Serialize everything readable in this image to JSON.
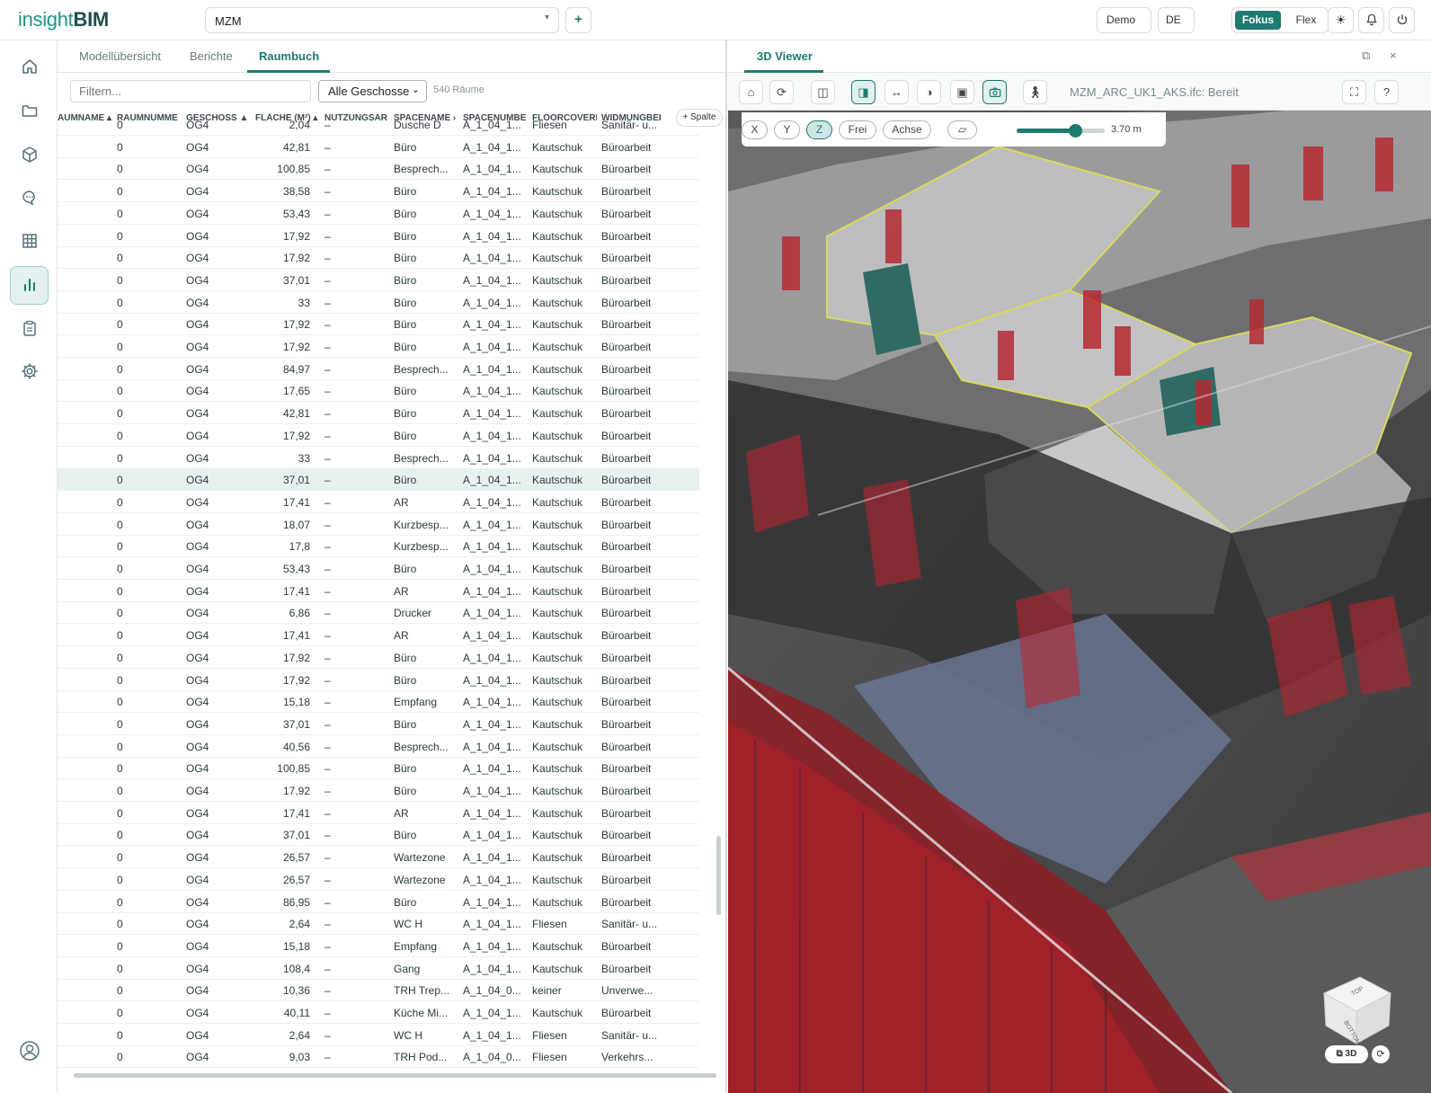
{
  "app": {
    "logo_light": "insight",
    "logo_bold": "BIM"
  },
  "header": {
    "project": "MZM",
    "add_label": "+",
    "demo": "Demo",
    "lang": "DE",
    "mode_fokus": "Fokus",
    "mode_flex": "Flex",
    "icons": [
      "sun-icon",
      "bell-icon",
      "power-icon"
    ]
  },
  "sidebar": [
    "home-icon",
    "folder-icon",
    "cube-icon",
    "chat-icon",
    "grid-icon",
    "chart-icon",
    "clipboard-icon",
    "gear-icon",
    "user-icon"
  ],
  "left": {
    "tabs": [
      "Modellübersicht",
      "Berichte",
      "Raumbuch"
    ],
    "active_tab": "Raumbuch",
    "filter_placeholder": "Filtern...",
    "floor_select": "Alle Geschosse",
    "room_count": "540 Räume",
    "columns": [
      "AUMNAME",
      "RAUMNUMME",
      "GESCHOSS ▲",
      "FLÄCHE (M²)",
      "NUTZUNGSAR",
      "SPACENAME",
      "SPACENUMBE",
      "FLOORCOVERI",
      "WIDMUNGBEI"
    ],
    "add_column": "+ Spalte",
    "rows": [
      [
        "0",
        "OG4",
        "2,04",
        "–",
        "Dusche D",
        "A_1_04_1...",
        "Fliesen",
        "Sanitär- u..."
      ],
      [
        "0",
        "OG4",
        "42,81",
        "–",
        "Büro",
        "A_1_04_1...",
        "Kautschuk",
        "Büroarbeit"
      ],
      [
        "0",
        "OG4",
        "100,85",
        "–",
        "Besprech...",
        "A_1_04_1...",
        "Kautschuk",
        "Büroarbeit"
      ],
      [
        "0",
        "OG4",
        "38,58",
        "–",
        "Büro",
        "A_1_04_1...",
        "Kautschuk",
        "Büroarbeit"
      ],
      [
        "0",
        "OG4",
        "53,43",
        "–",
        "Büro",
        "A_1_04_1...",
        "Kautschuk",
        "Büroarbeit"
      ],
      [
        "0",
        "OG4",
        "17,92",
        "–",
        "Büro",
        "A_1_04_1...",
        "Kautschuk",
        "Büroarbeit"
      ],
      [
        "0",
        "OG4",
        "17,92",
        "–",
        "Büro",
        "A_1_04_1...",
        "Kautschuk",
        "Büroarbeit"
      ],
      [
        "0",
        "OG4",
        "37,01",
        "–",
        "Büro",
        "A_1_04_1...",
        "Kautschuk",
        "Büroarbeit"
      ],
      [
        "0",
        "OG4",
        "33",
        "–",
        "Büro",
        "A_1_04_1...",
        "Kautschuk",
        "Büroarbeit"
      ],
      [
        "0",
        "OG4",
        "17,92",
        "–",
        "Büro",
        "A_1_04_1...",
        "Kautschuk",
        "Büroarbeit"
      ],
      [
        "0",
        "OG4",
        "17,92",
        "–",
        "Büro",
        "A_1_04_1...",
        "Kautschuk",
        "Büroarbeit"
      ],
      [
        "0",
        "OG4",
        "84,97",
        "–",
        "Besprech...",
        "A_1_04_1...",
        "Kautschuk",
        "Büroarbeit"
      ],
      [
        "0",
        "OG4",
        "17,65",
        "–",
        "Büro",
        "A_1_04_1...",
        "Kautschuk",
        "Büroarbeit"
      ],
      [
        "0",
        "OG4",
        "42,81",
        "–",
        "Büro",
        "A_1_04_1...",
        "Kautschuk",
        "Büroarbeit"
      ],
      [
        "0",
        "OG4",
        "17,92",
        "–",
        "Büro",
        "A_1_04_1...",
        "Kautschuk",
        "Büroarbeit"
      ],
      [
        "0",
        "OG4",
        "33",
        "–",
        "Besprech...",
        "A_1_04_1...",
        "Kautschuk",
        "Büroarbeit"
      ],
      [
        "0",
        "OG4",
        "37,01",
        "–",
        "Büro",
        "A_1_04_1...",
        "Kautschuk",
        "Büroarbeit"
      ],
      [
        "0",
        "OG4",
        "17,41",
        "–",
        "AR",
        "A_1_04_1...",
        "Kautschuk",
        "Büroarbeit"
      ],
      [
        "0",
        "OG4",
        "18,07",
        "–",
        "Kurzbesp...",
        "A_1_04_1...",
        "Kautschuk",
        "Büroarbeit"
      ],
      [
        "0",
        "OG4",
        "17,8",
        "–",
        "Kurzbesp...",
        "A_1_04_1...",
        "Kautschuk",
        "Büroarbeit"
      ],
      [
        "0",
        "OG4",
        "53,43",
        "–",
        "Büro",
        "A_1_04_1...",
        "Kautschuk",
        "Büroarbeit"
      ],
      [
        "0",
        "OG4",
        "17,41",
        "–",
        "AR",
        "A_1_04_1...",
        "Kautschuk",
        "Büroarbeit"
      ],
      [
        "0",
        "OG4",
        "6,86",
        "–",
        "Drucker",
        "A_1_04_1...",
        "Kautschuk",
        "Büroarbeit"
      ],
      [
        "0",
        "OG4",
        "17,41",
        "–",
        "AR",
        "A_1_04_1...",
        "Kautschuk",
        "Büroarbeit"
      ],
      [
        "0",
        "OG4",
        "17,92",
        "–",
        "Büro",
        "A_1_04_1...",
        "Kautschuk",
        "Büroarbeit"
      ],
      [
        "0",
        "OG4",
        "17,92",
        "–",
        "Büro",
        "A_1_04_1...",
        "Kautschuk",
        "Büroarbeit"
      ],
      [
        "0",
        "OG4",
        "15,18",
        "–",
        "Empfang",
        "A_1_04_1...",
        "Kautschuk",
        "Büroarbeit"
      ],
      [
        "0",
        "OG4",
        "37,01",
        "–",
        "Büro",
        "A_1_04_1...",
        "Kautschuk",
        "Büroarbeit"
      ],
      [
        "0",
        "OG4",
        "40,56",
        "–",
        "Besprech...",
        "A_1_04_1...",
        "Kautschuk",
        "Büroarbeit"
      ],
      [
        "0",
        "OG4",
        "100,85",
        "–",
        "Büro",
        "A_1_04_1...",
        "Kautschuk",
        "Büroarbeit"
      ],
      [
        "0",
        "OG4",
        "17,92",
        "–",
        "Büro",
        "A_1_04_1...",
        "Kautschuk",
        "Büroarbeit"
      ],
      [
        "0",
        "OG4",
        "17,41",
        "–",
        "AR",
        "A_1_04_1...",
        "Kautschuk",
        "Büroarbeit"
      ],
      [
        "0",
        "OG4",
        "37,01",
        "–",
        "Büro",
        "A_1_04_1...",
        "Kautschuk",
        "Büroarbeit"
      ],
      [
        "0",
        "OG4",
        "26,57",
        "–",
        "Wartezone",
        "A_1_04_1...",
        "Kautschuk",
        "Büroarbeit"
      ],
      [
        "0",
        "OG4",
        "26,57",
        "–",
        "Wartezone",
        "A_1_04_1...",
        "Kautschuk",
        "Büroarbeit"
      ],
      [
        "0",
        "OG4",
        "86,95",
        "–",
        "Büro",
        "A_1_04_1...",
        "Kautschuk",
        "Büroarbeit"
      ],
      [
        "0",
        "OG4",
        "2,64",
        "–",
        "WC H",
        "A_1_04_1...",
        "Fliesen",
        "Sanitär- u..."
      ],
      [
        "0",
        "OG4",
        "15,18",
        "–",
        "Empfang",
        "A_1_04_1...",
        "Kautschuk",
        "Büroarbeit"
      ],
      [
        "0",
        "OG4",
        "108,4",
        "–",
        "Gang",
        "A_1_04_1...",
        "Kautschuk",
        "Büroarbeit"
      ],
      [
        "0",
        "OG4",
        "10,36",
        "–",
        "TRH Trep...",
        "A_1_04_0...",
        "keiner",
        "Unverwe..."
      ],
      [
        "0",
        "OG4",
        "40,11",
        "–",
        "Küche Mi...",
        "A_1_04_1...",
        "Kautschuk",
        "Büroarbeit"
      ],
      [
        "0",
        "OG4",
        "2,64",
        "–",
        "WC H",
        "A_1_04_1...",
        "Fliesen",
        "Sanitär- u..."
      ],
      [
        "0",
        "OG4",
        "9,03",
        "–",
        "TRH Pod...",
        "A_1_04_0...",
        "Fliesen",
        "Verkehrs..."
      ]
    ],
    "selected_row": 16
  },
  "viewer": {
    "title": "3D Viewer",
    "status": "MZM_ARC_UK1_AKS.ifc: Bereit",
    "clip_axes": [
      "X",
      "Y",
      "Z",
      "Frei",
      "Achse"
    ],
    "active_axis": "Z",
    "clip_height": "3.70 m",
    "clip_slider_fraction": 0.66,
    "navcube_top": "TOP",
    "navcube_bottom": "BOTTOM",
    "view_mode": "⧉ 3D",
    "colors": {
      "accent": "#1f7a70",
      "wall": "#c9c9c9",
      "red": "#b3202a"
    }
  }
}
